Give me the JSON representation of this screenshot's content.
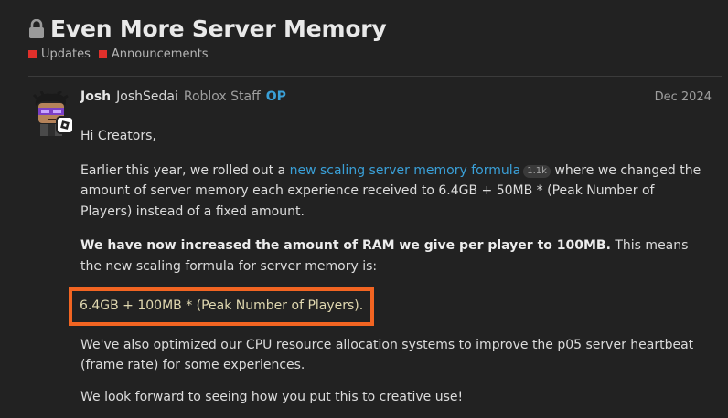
{
  "topic": {
    "title": "Even More Server Memory",
    "lock_icon": "lock-icon"
  },
  "categories": [
    {
      "label": "Updates",
      "color": "#e0302b"
    },
    {
      "label": "Announcements",
      "color": "#e0302b"
    }
  ],
  "post": {
    "author_name": "Josh",
    "author_username": "JoshSedai",
    "author_title": "Roblox Staff",
    "op_label": "OP",
    "date": "Dec 2024",
    "greeting": "Hi Creators,",
    "p1_before": "Earlier this year, we rolled out a ",
    "p1_link": "new scaling server memory formula",
    "p1_link_clicks": "1.1k",
    "p1_after": " where we changed the amount of server memory each experience received to 6.4GB + 50MB * (Peak Number of Players) instead of a fixed amount.",
    "p2_bold": "We have now increased the amount of RAM we give per player to 100MB.",
    "p2_after": " This means the new scaling formula for server memory is:",
    "formula": "6.4GB + 100MB * (Peak Number of Players).",
    "p3": "We've also optimized our CPU resource allocation systems to improve the p05 server heartbeat (frame rate) for some experiences.",
    "p4": "We look forward to seeing how you put this to creative use!"
  },
  "colors": {
    "background": "#222222",
    "link": "#3aa0d8",
    "category": "#e0302b",
    "highlight_border": "#f26522"
  }
}
